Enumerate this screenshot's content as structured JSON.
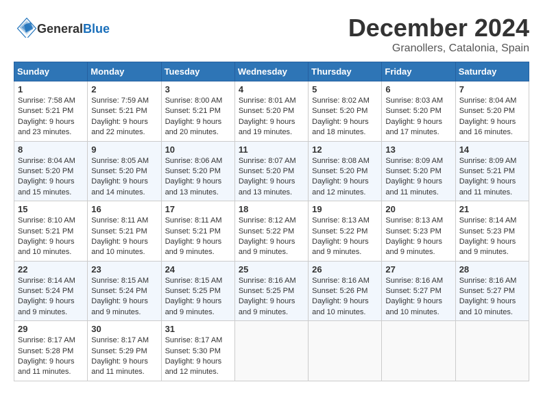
{
  "logo": {
    "general": "General",
    "blue": "Blue"
  },
  "title": "December 2024",
  "location": "Granollers, Catalonia, Spain",
  "days_of_week": [
    "Sunday",
    "Monday",
    "Tuesday",
    "Wednesday",
    "Thursday",
    "Friday",
    "Saturday"
  ],
  "weeks": [
    [
      {
        "day": "1",
        "sunrise": "7:58 AM",
        "sunset": "5:21 PM",
        "daylight": "9 hours and 23 minutes."
      },
      {
        "day": "2",
        "sunrise": "7:59 AM",
        "sunset": "5:21 PM",
        "daylight": "9 hours and 22 minutes."
      },
      {
        "day": "3",
        "sunrise": "8:00 AM",
        "sunset": "5:21 PM",
        "daylight": "9 hours and 20 minutes."
      },
      {
        "day": "4",
        "sunrise": "8:01 AM",
        "sunset": "5:20 PM",
        "daylight": "9 hours and 19 minutes."
      },
      {
        "day": "5",
        "sunrise": "8:02 AM",
        "sunset": "5:20 PM",
        "daylight": "9 hours and 18 minutes."
      },
      {
        "day": "6",
        "sunrise": "8:03 AM",
        "sunset": "5:20 PM",
        "daylight": "9 hours and 17 minutes."
      },
      {
        "day": "7",
        "sunrise": "8:04 AM",
        "sunset": "5:20 PM",
        "daylight": "9 hours and 16 minutes."
      }
    ],
    [
      {
        "day": "8",
        "sunrise": "8:04 AM",
        "sunset": "5:20 PM",
        "daylight": "9 hours and 15 minutes."
      },
      {
        "day": "9",
        "sunrise": "8:05 AM",
        "sunset": "5:20 PM",
        "daylight": "9 hours and 14 minutes."
      },
      {
        "day": "10",
        "sunrise": "8:06 AM",
        "sunset": "5:20 PM",
        "daylight": "9 hours and 13 minutes."
      },
      {
        "day": "11",
        "sunrise": "8:07 AM",
        "sunset": "5:20 PM",
        "daylight": "9 hours and 13 minutes."
      },
      {
        "day": "12",
        "sunrise": "8:08 AM",
        "sunset": "5:20 PM",
        "daylight": "9 hours and 12 minutes."
      },
      {
        "day": "13",
        "sunrise": "8:09 AM",
        "sunset": "5:20 PM",
        "daylight": "9 hours and 11 minutes."
      },
      {
        "day": "14",
        "sunrise": "8:09 AM",
        "sunset": "5:21 PM",
        "daylight": "9 hours and 11 minutes."
      }
    ],
    [
      {
        "day": "15",
        "sunrise": "8:10 AM",
        "sunset": "5:21 PM",
        "daylight": "9 hours and 10 minutes."
      },
      {
        "day": "16",
        "sunrise": "8:11 AM",
        "sunset": "5:21 PM",
        "daylight": "9 hours and 10 minutes."
      },
      {
        "day": "17",
        "sunrise": "8:11 AM",
        "sunset": "5:21 PM",
        "daylight": "9 hours and 9 minutes."
      },
      {
        "day": "18",
        "sunrise": "8:12 AM",
        "sunset": "5:22 PM",
        "daylight": "9 hours and 9 minutes."
      },
      {
        "day": "19",
        "sunrise": "8:13 AM",
        "sunset": "5:22 PM",
        "daylight": "9 hours and 9 minutes."
      },
      {
        "day": "20",
        "sunrise": "8:13 AM",
        "sunset": "5:23 PM",
        "daylight": "9 hours and 9 minutes."
      },
      {
        "day": "21",
        "sunrise": "8:14 AM",
        "sunset": "5:23 PM",
        "daylight": "9 hours and 9 minutes."
      }
    ],
    [
      {
        "day": "22",
        "sunrise": "8:14 AM",
        "sunset": "5:24 PM",
        "daylight": "9 hours and 9 minutes."
      },
      {
        "day": "23",
        "sunrise": "8:15 AM",
        "sunset": "5:24 PM",
        "daylight": "9 hours and 9 minutes."
      },
      {
        "day": "24",
        "sunrise": "8:15 AM",
        "sunset": "5:25 PM",
        "daylight": "9 hours and 9 minutes."
      },
      {
        "day": "25",
        "sunrise": "8:16 AM",
        "sunset": "5:25 PM",
        "daylight": "9 hours and 9 minutes."
      },
      {
        "day": "26",
        "sunrise": "8:16 AM",
        "sunset": "5:26 PM",
        "daylight": "9 hours and 10 minutes."
      },
      {
        "day": "27",
        "sunrise": "8:16 AM",
        "sunset": "5:27 PM",
        "daylight": "9 hours and 10 minutes."
      },
      {
        "day": "28",
        "sunrise": "8:16 AM",
        "sunset": "5:27 PM",
        "daylight": "9 hours and 10 minutes."
      }
    ],
    [
      {
        "day": "29",
        "sunrise": "8:17 AM",
        "sunset": "5:28 PM",
        "daylight": "9 hours and 11 minutes."
      },
      {
        "day": "30",
        "sunrise": "8:17 AM",
        "sunset": "5:29 PM",
        "daylight": "9 hours and 11 minutes."
      },
      {
        "day": "31",
        "sunrise": "8:17 AM",
        "sunset": "5:30 PM",
        "daylight": "9 hours and 12 minutes."
      },
      null,
      null,
      null,
      null
    ]
  ],
  "labels": {
    "sunrise": "Sunrise:",
    "sunset": "Sunset:",
    "daylight": "Daylight:"
  }
}
